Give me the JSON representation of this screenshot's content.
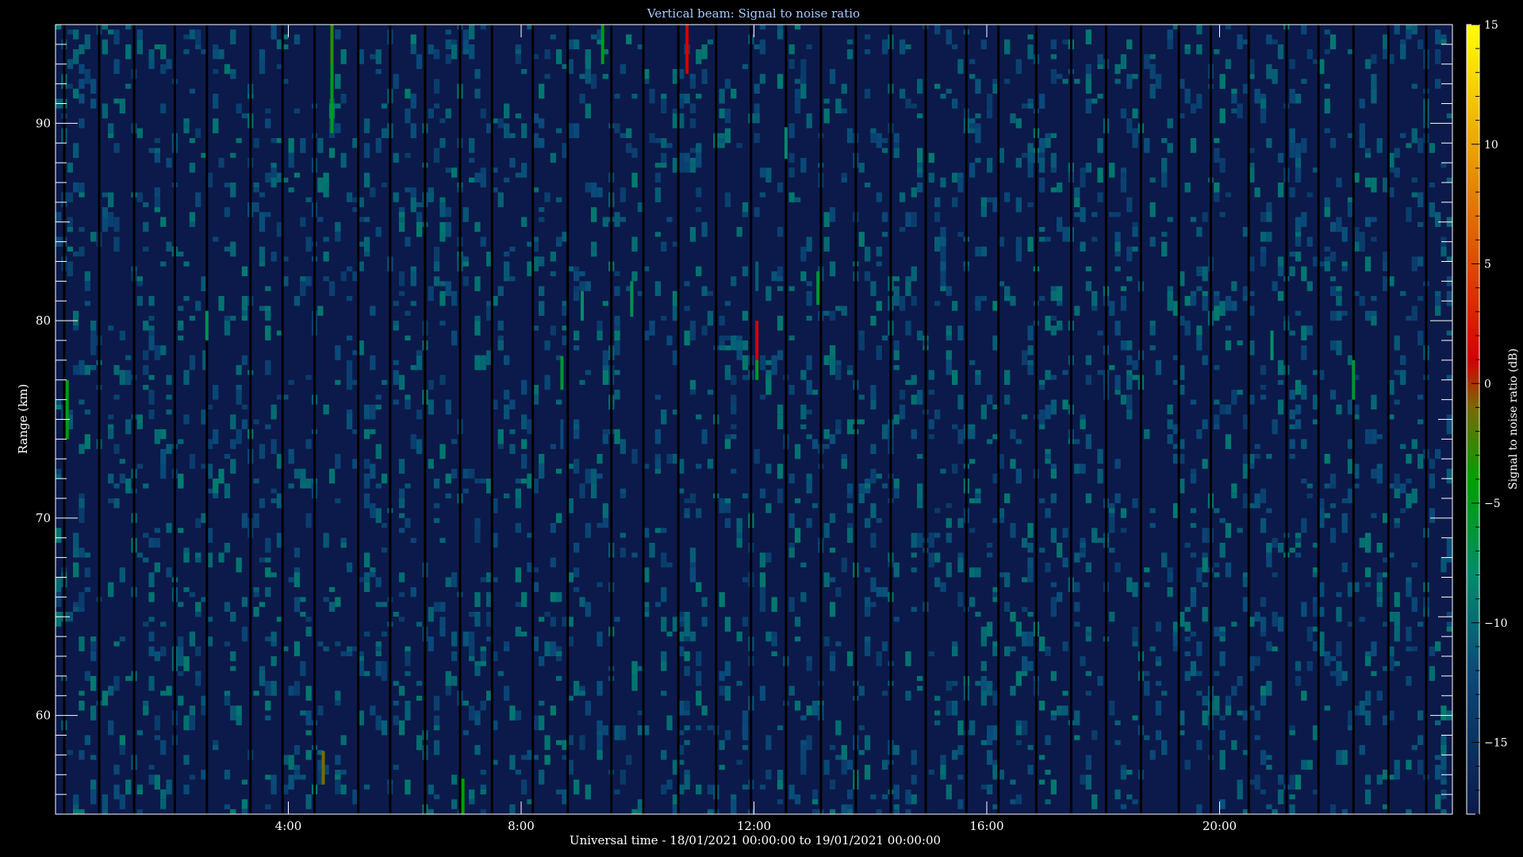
{
  "chart_data": {
    "type": "heatmap",
    "title": "Vertical beam: Signal to noise ratio",
    "xlabel": "Universal time - 18/01/2021 00:00:00 to 19/01/2021 00:00:00",
    "ylabel": "Range (km)",
    "xlim_hours": [
      0,
      24
    ],
    "ylim_km": [
      55,
      95
    ],
    "x_ticks": [
      {
        "hour": 4,
        "label": "4:00"
      },
      {
        "hour": 8,
        "label": "8:00"
      },
      {
        "hour": 12,
        "label": "12:00"
      },
      {
        "hour": 16,
        "label": "16:00"
      },
      {
        "hour": 20,
        "label": "20:00"
      }
    ],
    "y_ticks": [
      {
        "km": 60,
        "label": "60"
      },
      {
        "km": 70,
        "label": "70"
      },
      {
        "km": 80,
        "label": "80"
      },
      {
        "km": 90,
        "label": "90"
      }
    ],
    "colorbar": {
      "label": "Signal to noise ratio (dB)",
      "range": [
        -18,
        15
      ],
      "ticks": [
        {
          "value": 15,
          "label": "15"
        },
        {
          "value": 10,
          "label": "10"
        },
        {
          "value": 5,
          "label": "5"
        },
        {
          "value": 0,
          "label": "0"
        },
        {
          "value": -5,
          "label": "−5"
        },
        {
          "value": -10,
          "label": "−10"
        },
        {
          "value": -15,
          "label": "−15"
        }
      ],
      "stops": [
        {
          "value": -18,
          "color": "#0b1a4a"
        },
        {
          "value": -12,
          "color": "#0a4a7a"
        },
        {
          "value": -8,
          "color": "#008c6a"
        },
        {
          "value": -4,
          "color": "#00a000"
        },
        {
          "value": -1,
          "color": "#7a6a00"
        },
        {
          "value": 1,
          "color": "#d40000"
        },
        {
          "value": 7,
          "color": "#e07000"
        },
        {
          "value": 15,
          "color": "#ffff00"
        }
      ]
    },
    "background_snr_db": -16,
    "data_gaps_hours": [
      0.15,
      0.75,
      1.35,
      2.05,
      2.6,
      3.35,
      3.9,
      4.45,
      5.2,
      5.75,
      6.35,
      6.95,
      7.5,
      8.2,
      8.8,
      9.55,
      10.1,
      10.7,
      11.35,
      11.95,
      12.55,
      13.15,
      13.75,
      14.35,
      14.95,
      15.65,
      16.2,
      16.85,
      17.45,
      18.05,
      18.65,
      19.3,
      19.85,
      20.5,
      21.15,
      21.7,
      22.3,
      22.9,
      23.55
    ],
    "echoes": [
      {
        "hour": 0.2,
        "km_from": 74.0,
        "km_to": 77.0,
        "snr_db": -5
      },
      {
        "hour": 2.6,
        "km_from": 79.0,
        "km_to": 80.5,
        "snr_db": -7
      },
      {
        "hour": 2.55,
        "km_from": 77.5,
        "km_to": 78.5,
        "snr_db": -11
      },
      {
        "hour": 4.75,
        "km_from": 89.5,
        "km_to": 94.5,
        "snr_db": -5
      },
      {
        "hour": 4.75,
        "km_from": 93.0,
        "km_to": 95.0,
        "snr_db": -3
      },
      {
        "hour": 4.6,
        "km_from": 56.5,
        "km_to": 58.2,
        "snr_db": -1
      },
      {
        "hour": 7.0,
        "km_from": 55.0,
        "km_to": 56.8,
        "snr_db": -4
      },
      {
        "hour": 8.7,
        "km_from": 76.5,
        "km_to": 78.2,
        "snr_db": -6
      },
      {
        "hour": 8.7,
        "km_from": 73.5,
        "km_to": 75.0,
        "snr_db": -12
      },
      {
        "hour": 9.05,
        "km_from": 80.0,
        "km_to": 81.5,
        "snr_db": -8
      },
      {
        "hour": 9.4,
        "km_from": 93.0,
        "km_to": 95.0,
        "snr_db": -5
      },
      {
        "hour": 9.9,
        "km_from": 80.2,
        "km_to": 82.0,
        "snr_db": -7
      },
      {
        "hour": 10.85,
        "km_from": 92.5,
        "km_to": 95.0,
        "snr_db": 1
      },
      {
        "hour": 12.05,
        "km_from": 77.5,
        "km_to": 80.0,
        "snr_db": 1
      },
      {
        "hour": 12.05,
        "km_from": 77.0,
        "km_to": 78.0,
        "snr_db": -5
      },
      {
        "hour": 12.05,
        "km_from": 81.5,
        "km_to": 83.0,
        "snr_db": -11
      },
      {
        "hour": 12.55,
        "km_from": 88.2,
        "km_to": 89.8,
        "snr_db": -8
      },
      {
        "hour": 13.1,
        "km_from": 80.8,
        "km_to": 82.5,
        "snr_db": -6
      },
      {
        "hour": 20.9,
        "km_from": 78.0,
        "km_to": 79.5,
        "snr_db": -8
      },
      {
        "hour": 22.3,
        "km_from": 76.0,
        "km_to": 78.0,
        "snr_db": -6
      }
    ]
  }
}
